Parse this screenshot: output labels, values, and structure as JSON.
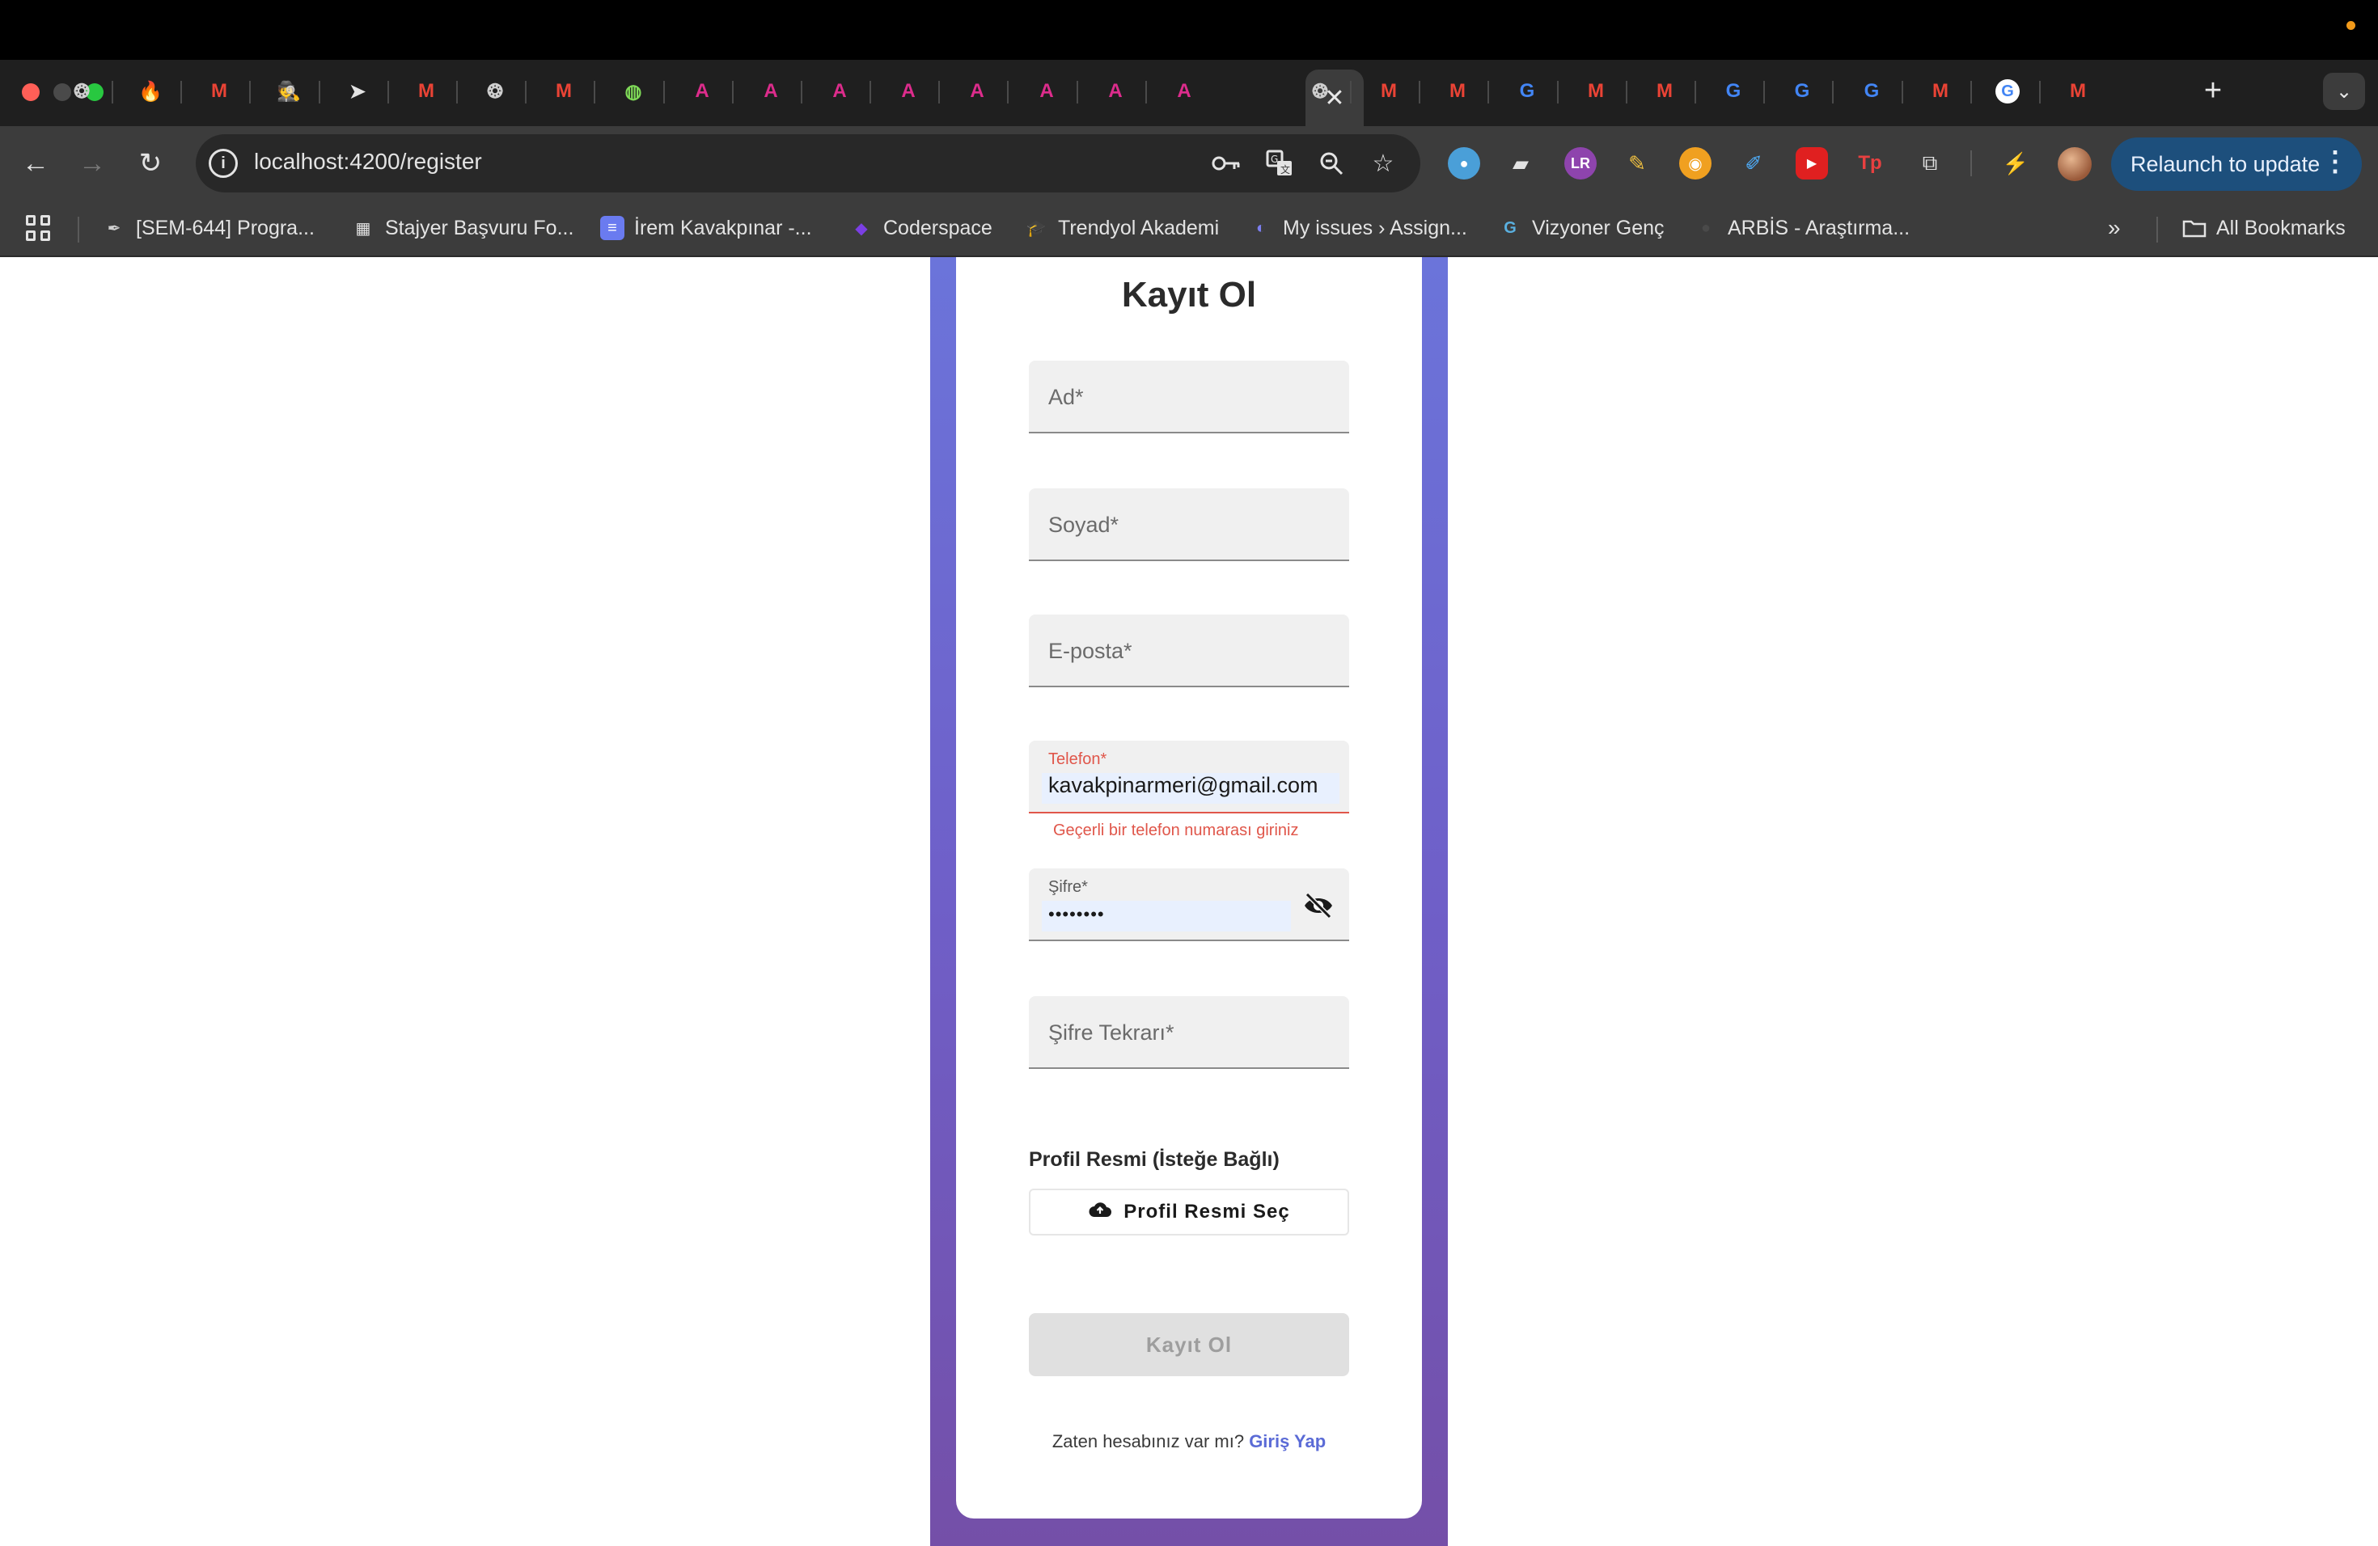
{
  "browser": {
    "tabs": {
      "favicons": [
        "chatgpt-icon",
        "fire-icon",
        "gmail-icon",
        "incognito-icon",
        "send-icon",
        "gmail-icon",
        "chatgpt-icon",
        "gmail-icon",
        "globe-icon",
        "angular-icon",
        "angular-icon",
        "angular-icon",
        "angular-icon",
        "angular-icon",
        "angular-icon",
        "angular-icon",
        "angular-icon",
        "close-icon",
        "chatgpt-icon",
        "gmail-icon",
        "gmail-icon",
        "google-icon",
        "gmail-icon",
        "gmail-icon",
        "google-icon",
        "google-icon",
        "google-icon",
        "gmail-icon",
        "chrome-google-icon",
        "gmail-icon"
      ]
    },
    "address_bar": {
      "url": "localhost:4200/register"
    },
    "relaunch_label": "Relaunch to update",
    "bookmarks": [
      {
        "label": "[SEM-644] Progra...",
        "icon": "feather-icon"
      },
      {
        "label": "Stajyer Başvuru Fo...",
        "icon": "cube-icon"
      },
      {
        "label": "İrem Kavakpınar -...",
        "icon": "doc-icon"
      },
      {
        "label": "Coderspace",
        "icon": "coderspace-icon"
      },
      {
        "label": "Trendyol Akademi",
        "icon": "academy-icon"
      },
      {
        "label": "My issues › Assign...",
        "icon": "linear-icon"
      },
      {
        "label": "Vizyoner Genç",
        "icon": "vg-icon"
      },
      {
        "label": "ARBİS - Araştırma...",
        "icon": "arbis-icon"
      }
    ],
    "all_bookmarks_label": "All Bookmarks",
    "accent": "#1d4f7c"
  },
  "form": {
    "title": "Kayıt Ol",
    "fields": {
      "ad": {
        "placeholder": "Ad*"
      },
      "soyad": {
        "placeholder": "Soyad*"
      },
      "eposta": {
        "placeholder": "E-posta*"
      },
      "telefon": {
        "label": "Telefon*",
        "value": "kavakpinarmeri@gmail.com",
        "error": "Geçerli bir telefon numarası giriniz"
      },
      "sifre": {
        "label": "Şifre*",
        "value": "••••••••"
      },
      "sifre_tekrar": {
        "placeholder": "Şifre Tekrarı*"
      }
    },
    "profile_label": "Profil Resmi (İsteğe Bağlı)",
    "profile_button": "Profil Resmi Seç",
    "submit_label": "Kayıt Ol",
    "footer_text": "Zaten hesabınız var mı?",
    "login_link": "Giriş Yap",
    "colors": {
      "error": "#e0564a",
      "link": "#5b6bd6",
      "gradient_top": "#6b74da",
      "gradient_bottom": "#744fa8"
    }
  }
}
